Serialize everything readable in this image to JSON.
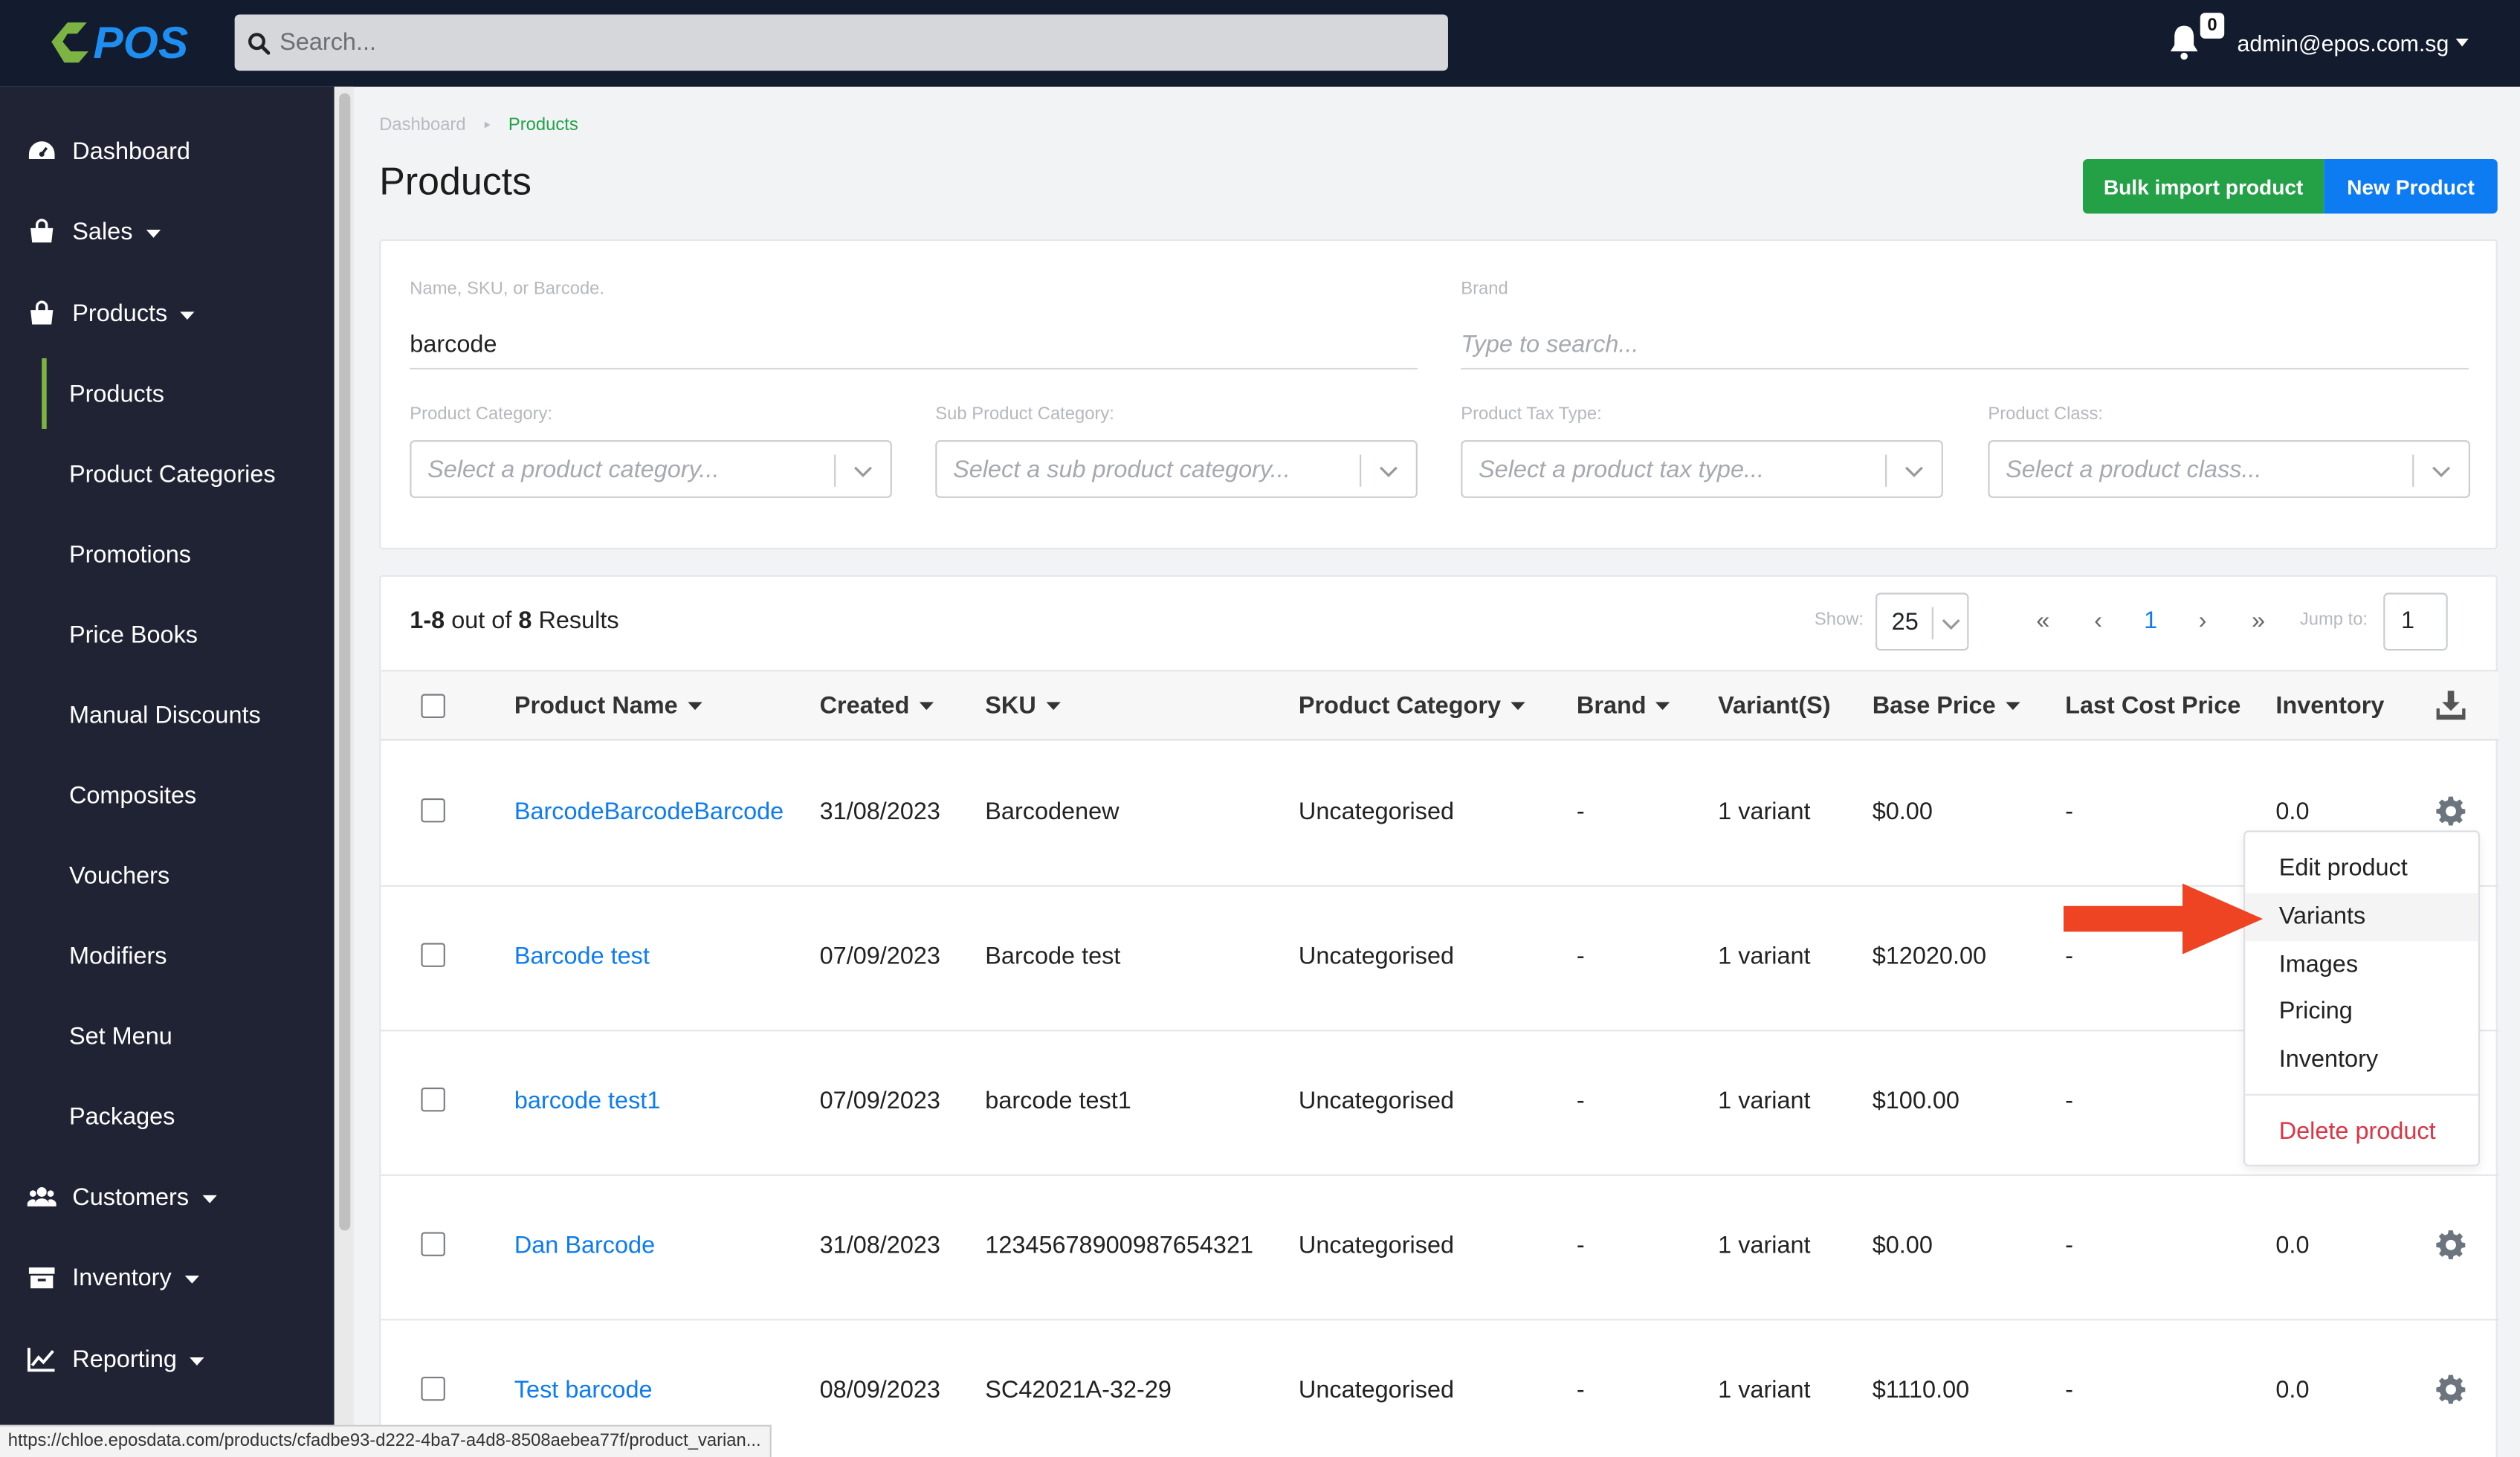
{
  "header": {
    "logo_text": "ePOS",
    "search_placeholder": "Search...",
    "notification_count": "0",
    "user_email": "admin@epos.com.sg"
  },
  "sidebar": {
    "items": [
      {
        "label": "Dashboard",
        "icon": "dashboard-icon",
        "caret": false
      },
      {
        "label": "Sales",
        "icon": "shopping-bag-icon",
        "caret": true
      },
      {
        "label": "Products",
        "icon": "shopping-bag-icon",
        "caret": true
      }
    ],
    "subitems": [
      "Products",
      "Product Categories",
      "Promotions",
      "Price Books",
      "Manual Discounts",
      "Composites",
      "Vouchers",
      "Modifiers",
      "Set Menu",
      "Packages"
    ],
    "bottom_items": [
      {
        "label": "Customers",
        "icon": "users-icon"
      },
      {
        "label": "Inventory",
        "icon": "archive-icon"
      },
      {
        "label": "Reporting",
        "icon": "chart-line-icon"
      }
    ]
  },
  "breadcrumb": {
    "home": "Dashboard",
    "current": "Products"
  },
  "page_title": "Products",
  "actions": {
    "bulk_import": "Bulk import product",
    "new_product": "New Product"
  },
  "filters": {
    "name_label": "Name, SKU, or Barcode.",
    "name_value": "barcode",
    "brand_label": "Brand",
    "brand_placeholder": "Type to search...",
    "category_label": "Product Category:",
    "category_placeholder": "Select a product category...",
    "subcategory_label": "Sub Product Category:",
    "subcategory_placeholder": "Select a sub product category...",
    "taxtype_label": "Product Tax Type:",
    "taxtype_placeholder": "Select a product tax type...",
    "class_label": "Product Class:",
    "class_placeholder": "Select a product class..."
  },
  "results": {
    "range": "1-8",
    "mid": "out of",
    "total": "8",
    "suffix": "Results"
  },
  "pagination": {
    "show_label": "Show:",
    "page_size": "25",
    "first": "«",
    "prev": "‹",
    "current": "1",
    "next": "›",
    "last": "»",
    "jump_label": "Jump to:",
    "jump_value": "1"
  },
  "table": {
    "columns": [
      "Product Name",
      "Created",
      "SKU",
      "Product Category",
      "Brand",
      "Variant(S)",
      "Base Price",
      "Last Cost Price",
      "Inventory"
    ],
    "rows": [
      {
        "name": "BarcodeBarcodeBarcode",
        "created": "31/08/2023",
        "sku": "Barcodenew",
        "category": "Uncategorised",
        "brand": "-",
        "variants": "1 variant",
        "base_price": "$0.00",
        "last_cost": "-",
        "inventory": "0.0"
      },
      {
        "name": "Barcode test",
        "created": "07/09/2023",
        "sku": "Barcode test",
        "category": "Uncategorised",
        "brand": "-",
        "variants": "1 variant",
        "base_price": "$12020.00",
        "last_cost": "-",
        "inventory": ""
      },
      {
        "name": "barcode test1",
        "created": "07/09/2023",
        "sku": "barcode test1",
        "category": "Uncategorised",
        "brand": "-",
        "variants": "1 variant",
        "base_price": "$100.00",
        "last_cost": "-",
        "inventory": ""
      },
      {
        "name": "Dan Barcode",
        "created": "31/08/2023",
        "sku": "12345678900987654321",
        "category": "Uncategorised",
        "brand": "-",
        "variants": "1 variant",
        "base_price": "$0.00",
        "last_cost": "-",
        "inventory": "0.0"
      },
      {
        "name": "Test barcode",
        "created": "08/09/2023",
        "sku": "SC42021A-32-29",
        "category": "Uncategorised",
        "brand": "-",
        "variants": "1 variant",
        "base_price": "$1110.00",
        "last_cost": "-",
        "inventory": "0.0"
      }
    ]
  },
  "row_menu": {
    "items": [
      "Edit product",
      "Variants",
      "Images",
      "Pricing",
      "Inventory"
    ],
    "danger": "Delete product",
    "hovered": "Variants"
  },
  "status_url": "https://chloe.eposdata.com/products/cfadbe93-d222-4ba7-a4d8-8508aebea77f/product_varian...",
  "colors": {
    "topbar": "#131b2e",
    "sidebar": "#1f2333",
    "accent_green": "#24a147",
    "accent_blue": "#0d7cf2",
    "active_bar": "#7cb342",
    "danger": "#dc3545",
    "arrow": "#ee4424"
  }
}
